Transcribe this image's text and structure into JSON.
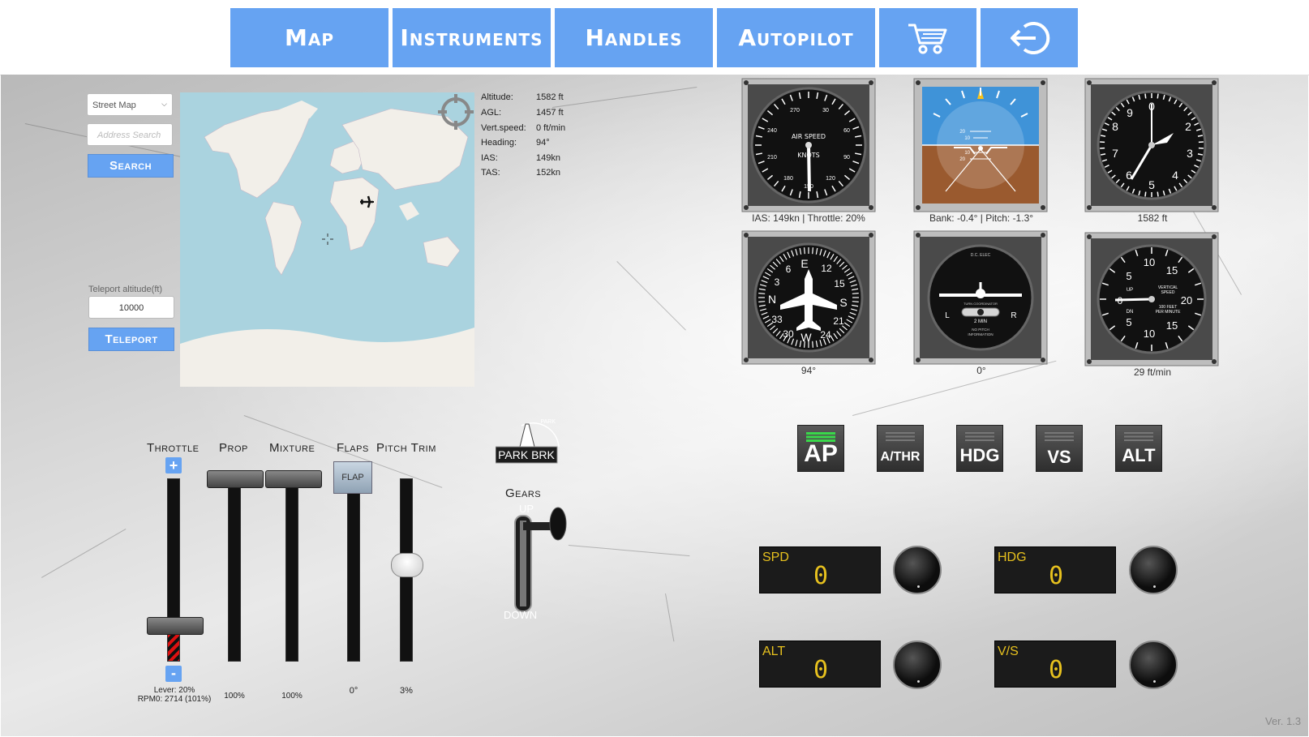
{
  "nav": {
    "map": "Map",
    "instruments": "Instruments",
    "handles": "Handles",
    "autopilot": "Autopilot"
  },
  "map_controls": {
    "layer_select": "Street Map",
    "address_placeholder": "Address Search",
    "search_button": "Search",
    "teleport_label": "Teleport altitude(ft)",
    "teleport_value": "10000",
    "teleport_button": "Teleport"
  },
  "flight_info": {
    "altitude_label": "Altitude:",
    "altitude": "1582 ft",
    "agl_label": "AGL:",
    "agl": "1457 ft",
    "vs_label": "Vert.speed:",
    "vs": "0 ft/min",
    "heading_label": "Heading:",
    "heading": "94°",
    "ias_label": "IAS:",
    "ias": "149kn",
    "tas_label": "TAS:",
    "tas": "152kn"
  },
  "gauges": {
    "airspeed_caption": "IAS: 149kn | Throttle: 20%",
    "attitude_caption": "Bank: -0.4° | Pitch: -1.3°",
    "altimeter_caption": "1582 ft",
    "heading_caption": "94°",
    "turn_caption": "0°",
    "vsi_caption": "29 ft/min",
    "airspeed_face": {
      "title": "AIR SPEED",
      "unit": "KNOTS",
      "ticks": [
        "270",
        "30",
        "240",
        "60",
        "210",
        "90",
        "180",
        "150",
        "120"
      ]
    },
    "altimeter_face": {
      "ticks": [
        "0",
        "2",
        "3",
        "4",
        "5",
        "6",
        "7",
        "8",
        "9"
      ]
    },
    "heading_face": {
      "ticks": [
        "E",
        "12",
        "15",
        "S",
        "21",
        "24",
        "W",
        "30",
        "33",
        "N",
        "3",
        "6"
      ]
    },
    "turn_face": {
      "top": "D.C. ELEC",
      "mid": "TURN COORDINATOR",
      "left": "L",
      "right": "R",
      "min": "2 MIN",
      "note1": "NO PITCH",
      "note2": "INFORMATION"
    },
    "vsi_face": {
      "ticks": [
        "10",
        "15",
        "5",
        "20",
        "0",
        "5",
        "15",
        "10"
      ],
      "up": "UP",
      "dn": "DN",
      "title1": "VERTICAL",
      "title2": "SPEED",
      "unit1": "100 FEET",
      "unit2": "PER MINUTE"
    },
    "attitude_face": {
      "ticks": [
        "20",
        "10",
        "10",
        "20"
      ]
    }
  },
  "handles": {
    "throttle_label": "Throttle",
    "prop_label": "Prop",
    "mixture_label": "Mixture",
    "flaps_label": "Flaps",
    "pitch_trim_label": "Pitch Trim",
    "throttle_plus": "+",
    "throttle_minus": "-",
    "throttle_readout_1": "Lever: 20%",
    "throttle_readout_2": "RPM0: 2714 (101%)",
    "prop_value": "100%",
    "mixture_value": "100%",
    "flaps_value": "0°",
    "flap_knob": "FLAP",
    "pitch_trim_value": "3%",
    "throttle_level": 0.2,
    "prop_level": 1.0,
    "mixture_level": 1.0,
    "trim_level": 0.53,
    "park_brake_label": "PARK BRK",
    "park_brake_park": "PARK",
    "gears_label": "Gears",
    "gears_up": "UP",
    "gears_down": "DOWN"
  },
  "autopilot": {
    "ap": "AP",
    "athr": "A/THR",
    "hdg": "HDG",
    "vs": "VS",
    "alt": "ALT",
    "spd_label": "SPD",
    "spd_value": "0",
    "hdg_label": "HDG",
    "hdg_value": "0",
    "alt_label": "ALT",
    "alt_value": "0",
    "vs_label": "V/S",
    "vs_value": "0",
    "active_color": "#39d84a"
  },
  "version": "Ver. 1.3"
}
